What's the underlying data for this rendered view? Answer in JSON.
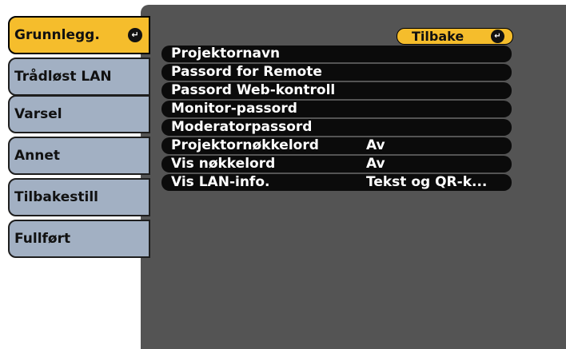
{
  "sidebar": {
    "tabs": [
      {
        "label": "Grunnlegg.",
        "active": true
      },
      {
        "label": "Trådløst LAN",
        "active": false
      },
      {
        "label": "Varsel",
        "active": false
      },
      {
        "label": "Annet",
        "active": false
      },
      {
        "label": "Tilbakestill",
        "active": false
      },
      {
        "label": "Fullført",
        "active": false
      }
    ],
    "enter_icon": "enter-icon"
  },
  "main": {
    "back_label": "Tilbake",
    "items": [
      {
        "label": "Projektornavn",
        "value": ""
      },
      {
        "label": "Passord for Remote",
        "value": ""
      },
      {
        "label": "Passord Web-kontroll",
        "value": ""
      },
      {
        "label": "Monitor-passord",
        "value": ""
      },
      {
        "label": "Moderatorpassord",
        "value": ""
      },
      {
        "label": "Projektornøkkelord",
        "value": "Av"
      },
      {
        "label": "Vis nøkkelord",
        "value": "Av"
      },
      {
        "label": "Vis LAN-info.",
        "value": "Tekst og QR-k..."
      }
    ]
  },
  "colors": {
    "accent": "#f5bd2c",
    "tab": "#a2b0c3",
    "panel": "#545454",
    "item": "#0b0b0b"
  }
}
